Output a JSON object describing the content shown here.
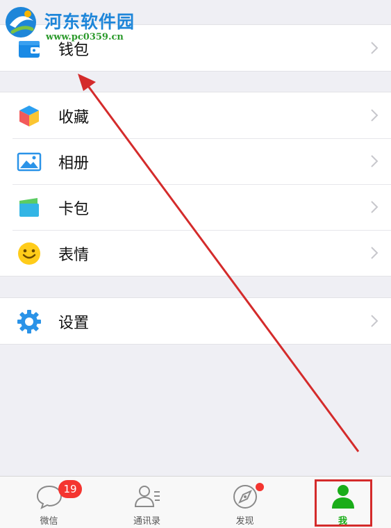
{
  "watermark": {
    "title": "河东软件园",
    "url": "www.pc0359.cn"
  },
  "groups": [
    {
      "items": [
        {
          "label": "钱包",
          "icon": "wallet-icon"
        }
      ]
    },
    {
      "items": [
        {
          "label": "收藏",
          "icon": "favorites-cube-icon"
        },
        {
          "label": "相册",
          "icon": "photo-album-icon"
        },
        {
          "label": "卡包",
          "icon": "card-wallet-icon"
        },
        {
          "label": "表情",
          "icon": "smiley-icon"
        }
      ]
    },
    {
      "items": [
        {
          "label": "设置",
          "icon": "gear-icon"
        }
      ]
    }
  ],
  "tabs": [
    {
      "label": "微信",
      "icon": "chat-bubble-icon",
      "badge": "19"
    },
    {
      "label": "通讯录",
      "icon": "contacts-icon"
    },
    {
      "label": "发现",
      "icon": "compass-icon",
      "has_dot": true
    },
    {
      "label": "我",
      "icon": "me-person-icon",
      "active": true
    }
  ],
  "colors": {
    "accent_green": "#1aad19",
    "badge_red": "#f43530",
    "annotation_red": "#d42b2b",
    "background": "#efeff4"
  }
}
